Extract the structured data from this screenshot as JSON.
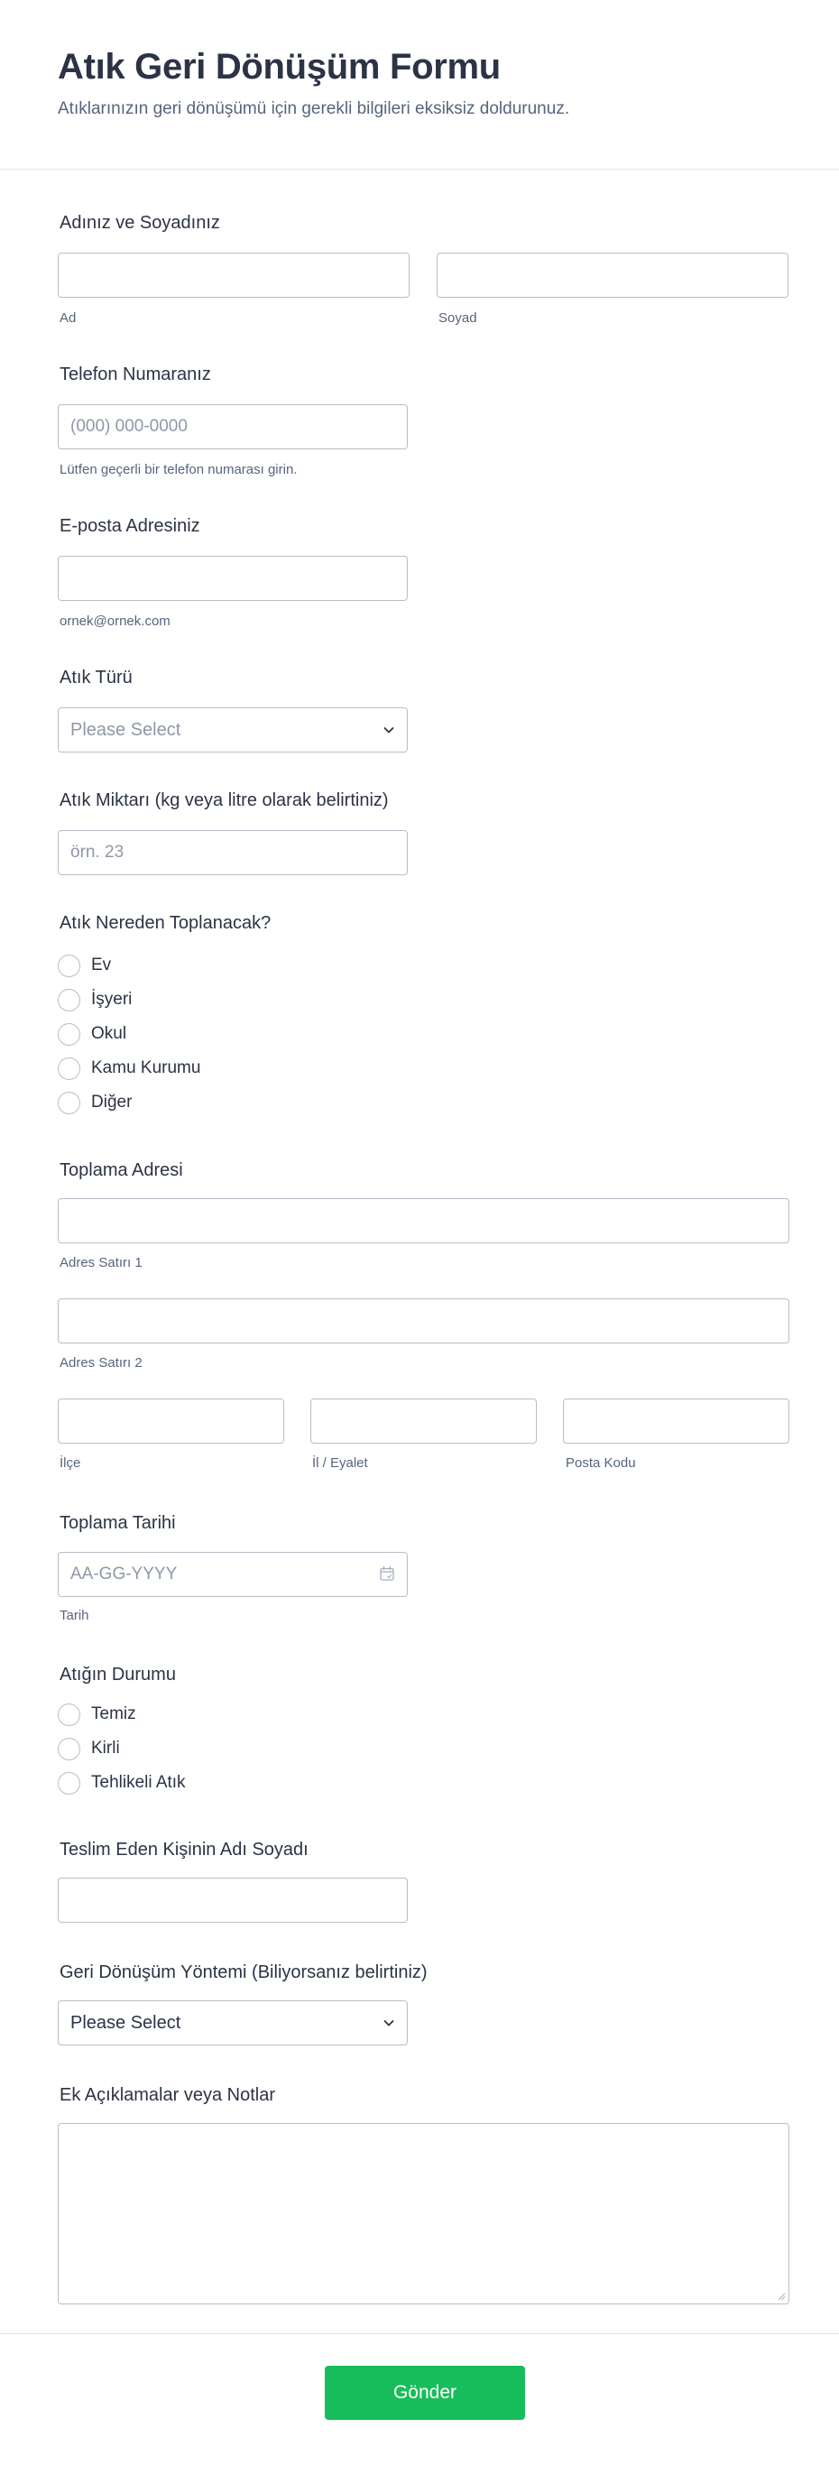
{
  "form": {
    "title": "Atık Geri Dönüşüm Formu",
    "subtitle": "Atıklarınızın geri dönüşümü için gerekli bilgileri eksiksiz doldurunuz."
  },
  "name": {
    "label": "Adınız ve Soyadınız",
    "first_sublabel": "Ad",
    "last_sublabel": "Soyad"
  },
  "phone": {
    "label": "Telefon Numaranız",
    "placeholder": "(000) 000-0000",
    "sublabel": "Lütfen geçerli bir telefon numarası girin."
  },
  "email": {
    "label": "E-posta Adresiniz",
    "sublabel": "ornek@ornek.com"
  },
  "waste_type": {
    "label": "Atık Türü",
    "selected": "Please Select"
  },
  "waste_amount": {
    "label": "Atık Miktarı (kg veya litre olarak belirtiniz)",
    "placeholder": "örn. 23"
  },
  "collection_source": {
    "label": "Atık Nereden Toplanacak?",
    "options": [
      "Ev",
      "İşyeri",
      "Okul",
      "Kamu Kurumu",
      "Diğer"
    ]
  },
  "address": {
    "label": "Toplama Adresi",
    "line1_sublabel": "Adres Satırı 1",
    "line2_sublabel": "Adres Satırı 2",
    "district_sublabel": "İlçe",
    "province_sublabel": "İl / Eyalet",
    "postal_sublabel": "Posta Kodu"
  },
  "collection_date": {
    "label": "Toplama Tarihi",
    "placeholder": "AA-GG-YYYY",
    "sublabel": "Tarih",
    "icon": "calendar-icon"
  },
  "waste_condition": {
    "label": "Atığın Durumu",
    "options": [
      "Temiz",
      "Kirli",
      "Tehlikeli Atık"
    ]
  },
  "deliverer": {
    "label": "Teslim Eden Kişinin Adı Soyadı"
  },
  "recycling_method": {
    "label": "Geri Dönüşüm Yöntemi (Biliyorsanız belirtiniz)",
    "selected": "Please Select"
  },
  "notes": {
    "label": "Ek Açıklamalar veya Notlar"
  },
  "submit": {
    "label": "Gönder",
    "color": "#18bd5b"
  }
}
